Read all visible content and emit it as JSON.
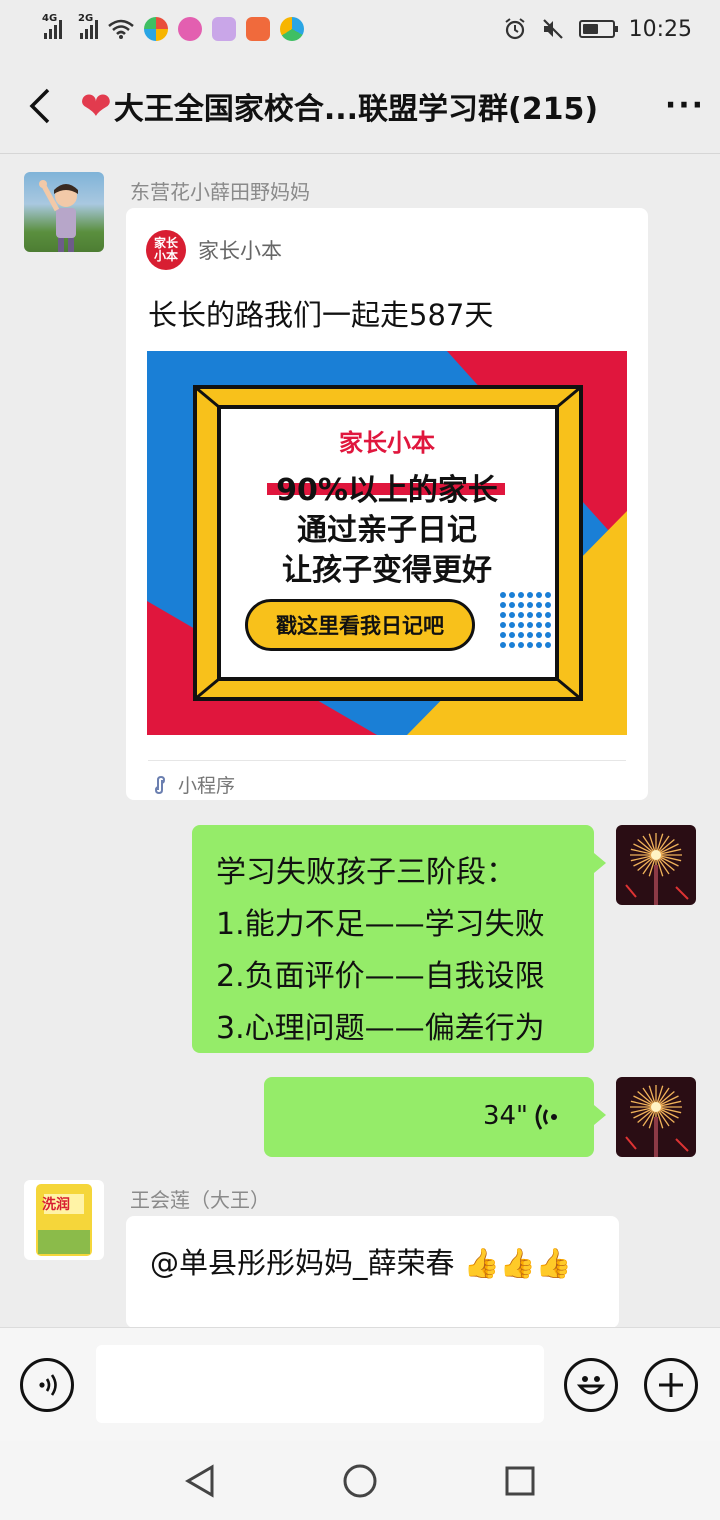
{
  "status_bar": {
    "net1": "4G",
    "net2": "2G",
    "time": "10:25",
    "battery_level": 0.55,
    "app_icons": [
      "weibo-icon",
      "game-center-icon",
      "music-icon",
      "ting-icon",
      "browser-icon"
    ]
  },
  "header": {
    "title_heart": "❤",
    "title": "大王全国家校合...联盟学习群(215)",
    "more": "···"
  },
  "messages": {
    "m1": {
      "sender": "东营花小薛田野妈妈",
      "card_source": "家长小本",
      "card_logo_text": "家长小本",
      "card_title": "长长的路我们一起走587天",
      "poster_brand": "家长小本",
      "poster_line1": "90%以上的家长",
      "poster_line2": "通过亲子日记",
      "poster_line3": "让孩子变得更好",
      "poster_button": "戳这里看我日记吧",
      "card_type": "小程序"
    },
    "m2": {
      "lines": [
        "学习失败孩子三阶段：",
        "1.能力不足——学习失败",
        "2.负面评价——自我设限",
        "3.心理问题——偏差行为"
      ]
    },
    "m3": {
      "duration": "34\""
    },
    "m4": {
      "sender": "王会莲（大王）",
      "text": "@单县彤彤妈妈_薛荣春 👍👍👍",
      "avatar_brand": "洗润"
    }
  },
  "input_bar": {
    "placeholder": ""
  },
  "colors": {
    "bubble_green": "#95ec69",
    "background": "#ededed",
    "brand_red": "#d81e32",
    "poster_blue": "#1a7fd6",
    "poster_red": "#e0163d",
    "poster_yellow": "#f8c11b"
  }
}
